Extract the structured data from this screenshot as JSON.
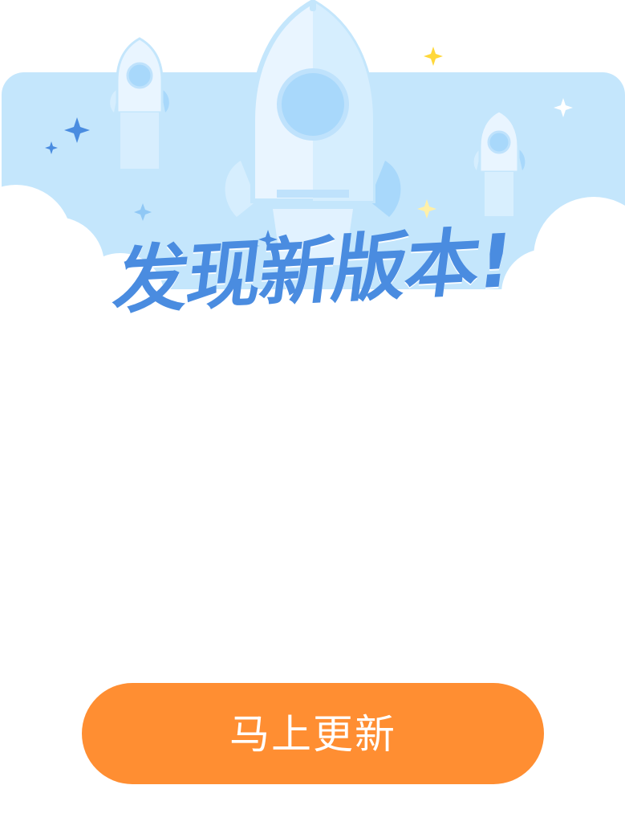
{
  "dialog": {
    "title": "发现新版本!",
    "update_button_label": "马上更新"
  },
  "colors": {
    "sky": "#C4E6FC",
    "title": "#4A8CE0",
    "button": "#FF8E32",
    "button_text": "#FFFFFF",
    "star_blue": "#4A8CE0",
    "star_yellow": "#FFD83A",
    "rocket_light": "#E9F5FF",
    "rocket_window": "#A8D8FB"
  },
  "icons": {
    "main": "rocket-icon",
    "decor": "sparkle-star-icon"
  }
}
